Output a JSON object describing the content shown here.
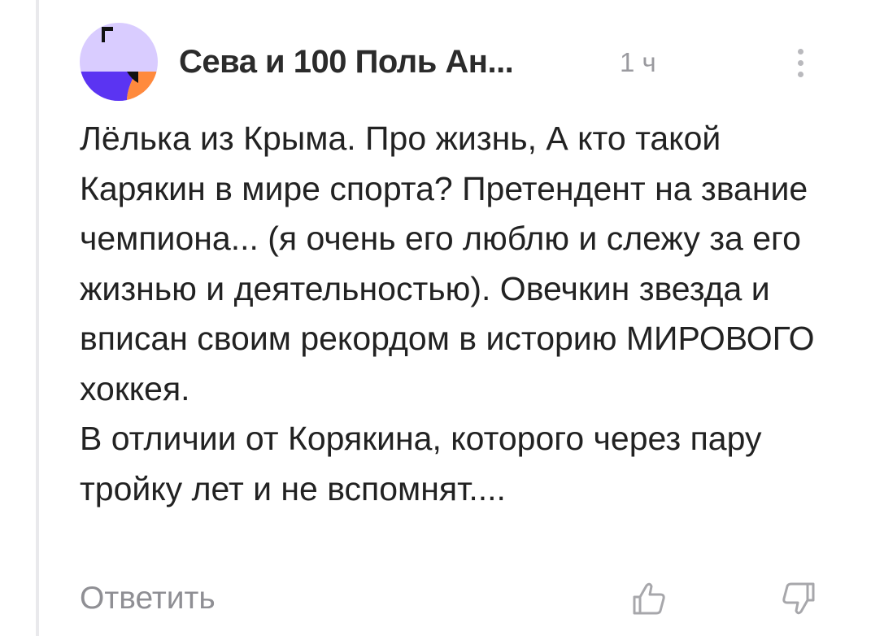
{
  "comment": {
    "author": "Сева и 100 Поль Ан...",
    "time": "1 ч",
    "text": "Лёлька из Крыма. Про жизнь, А кто такой Карякин в мире спорта? Претендент на звание чемпиона... (я очень его люблю и слежу за его жизнью и деятельностью). Овечкин звезда и вписан своим рекордом в историю МИРОВОГО хоккея.\nВ отличии от Корякина, которого через пару тройку лет и не вспомнят....",
    "reply_label": "Ответить"
  },
  "icons": {
    "avatar": "avatar-logo-icon",
    "more": "more-vertical-icon",
    "like": "thumbs-up-icon",
    "dislike": "thumbs-down-icon"
  },
  "colors": {
    "avatar_bg": "#d9ccff",
    "avatar_accent_blue": "#5b34f2",
    "avatar_accent_orange": "#ff8a3d",
    "muted": "#9a9a9f"
  }
}
